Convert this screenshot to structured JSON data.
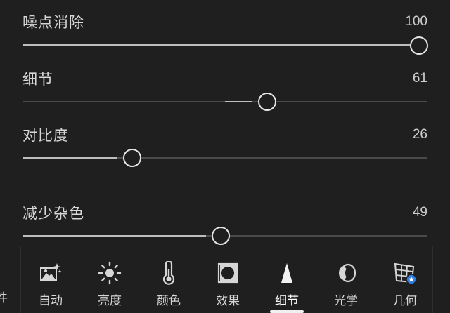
{
  "sliders": [
    {
      "label": "噪点消除",
      "value": "100",
      "level": 1.0
    },
    {
      "label": "细节",
      "value": "61",
      "level": 0.61
    },
    {
      "label": "对比度",
      "value": "26",
      "level": 0.26
    },
    {
      "label": "减少杂色",
      "value": "49",
      "level": 0.49
    }
  ],
  "toolbar": {
    "left_cut_label": "件",
    "items": [
      {
        "label": "自动",
        "icon": "auto-enhance-icon"
      },
      {
        "label": "亮度",
        "icon": "sun-icon"
      },
      {
        "label": "颜色",
        "icon": "thermometer-icon"
      },
      {
        "label": "效果",
        "icon": "vignette-icon"
      },
      {
        "label": "细节",
        "icon": "triangle-detail-icon",
        "active": true
      },
      {
        "label": "光学",
        "icon": "lens-icon"
      },
      {
        "label": "几何",
        "icon": "grid-perspective-icon"
      }
    ]
  },
  "colors": {
    "accent": "#f0f0f0",
    "background": "#1f1f1f",
    "badge": "#2f7ce0"
  }
}
